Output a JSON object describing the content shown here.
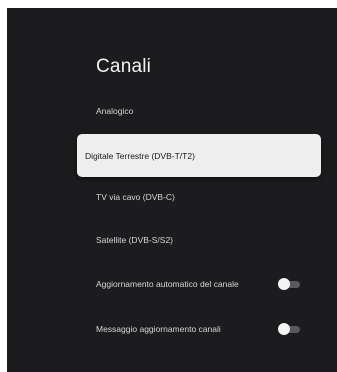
{
  "panel": {
    "title": "Canali"
  },
  "menu": {
    "items": [
      {
        "label": "Analogico",
        "focused": false
      },
      {
        "label": "Digitale Terrestre (DVB-T/T2)",
        "focused": true
      },
      {
        "label": "TV via cavo (DVB-C)",
        "focused": false
      },
      {
        "label": "Satellite (DVB-S/S2)",
        "focused": false
      },
      {
        "label": "Aggiornamento automatico del canale",
        "toggle": "off"
      },
      {
        "label": "Messaggio aggiornamento canali",
        "toggle": "off"
      }
    ]
  },
  "colors": {
    "background": "#1c1c1e",
    "focus_background": "#eeeeee",
    "toggle_track_off": "#5a5a5e",
    "toggle_knob": "#f4f4f4"
  }
}
